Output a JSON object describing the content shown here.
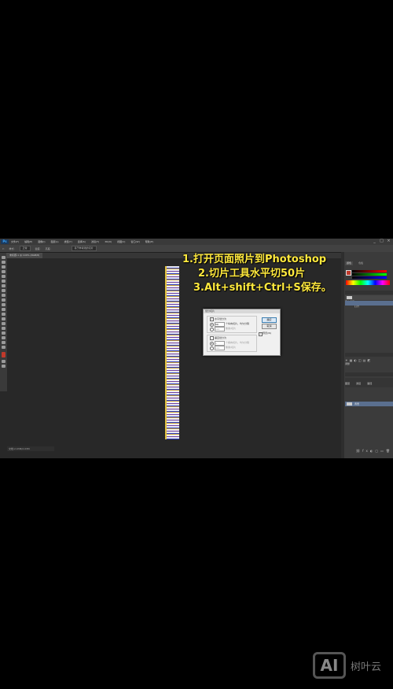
{
  "app": {
    "logo": "Ps",
    "menu": [
      "文件(F)",
      "编辑(E)",
      "图像(I)",
      "图层(L)",
      "类型(Y)",
      "选择(S)",
      "滤镜(T)",
      "3D(D)",
      "视图(V)",
      "窗口(W)",
      "帮助(H)"
    ],
    "window_controls": [
      "_",
      "□",
      "×"
    ]
  },
  "options_bar": {
    "style_label": "样式:",
    "style_value": "正常",
    "width_label": "宽度:",
    "height_label": "高度:",
    "slices_button": "基于参考线的切片"
  },
  "document_tab": {
    "label": "未标题-1 @ 100% (RGB/8)"
  },
  "status_bar": {
    "text": "文档:2.03M/2.03M"
  },
  "overlay_text": {
    "line1": "1.打开页面照片到Photoshop",
    "line2": "2.切片工具水平切50片",
    "line3": "3.Alt+shift+Ctrl+S保存。",
    "color": "#ffe93d"
  },
  "dialog": {
    "title": "划分切片",
    "horizontal_checkbox": "水平划分为",
    "horizontal_value": "50",
    "horizontal_unit": "个纵向切片，均匀分隔",
    "horizontal_px_value": "xxx",
    "horizontal_px_unit": "像素/切片",
    "vertical_checkbox": "垂直划分为",
    "vertical_value": "1",
    "vertical_unit": "个横向切片，均匀分隔",
    "vertical_px_value": "xxx",
    "vertical_px_unit": "像素/切片",
    "ok_button": "确定",
    "cancel_button": "取消",
    "preview_checkbox": "预览(W)"
  },
  "right_panel": {
    "color_tab": "颜色",
    "swatches_tab": "色板",
    "history_tab": "历史记录",
    "history_item": "打开",
    "adjust_title": "调整",
    "layers_tabs": [
      "图层",
      "通道",
      "路径"
    ],
    "layer_name": "背景"
  },
  "watermark": {
    "logo": "AI",
    "name": "树叶云"
  }
}
